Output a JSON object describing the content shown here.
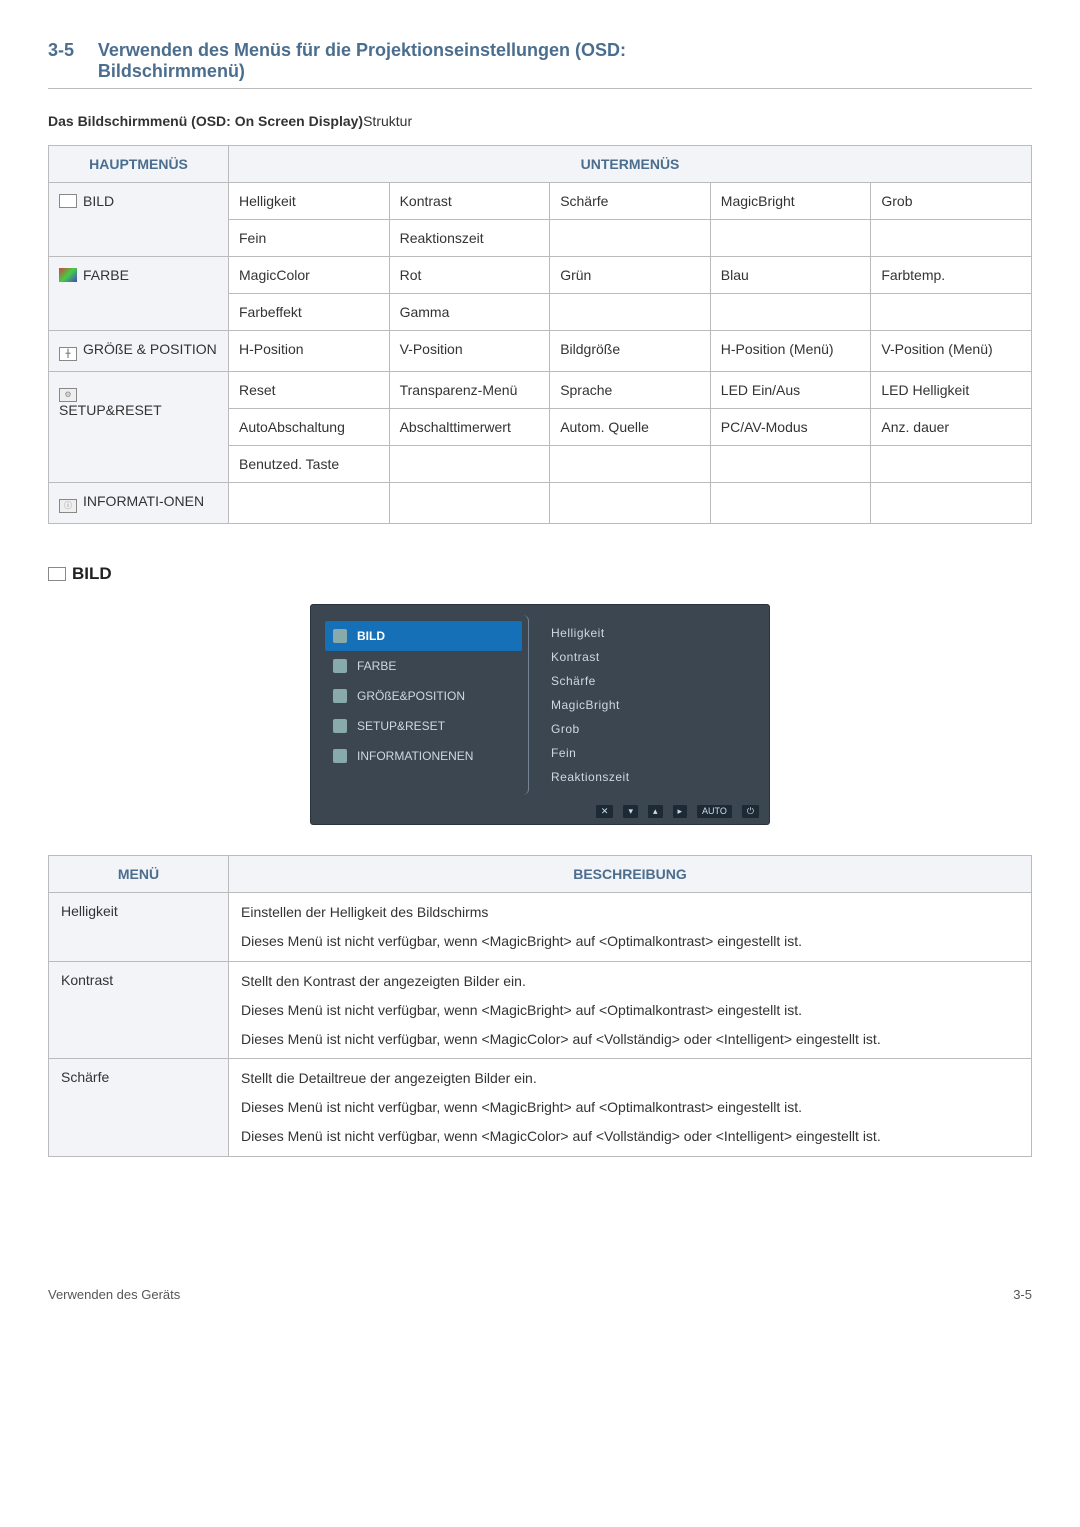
{
  "header": {
    "number": "3-5",
    "title_line1": "Verwenden des Menüs für die Projektionseinstellungen (OSD:",
    "title_line2": "Bildschirmmenü)"
  },
  "intro_bold": "Das Bildschirmmenü (OSD: On Screen Display)",
  "intro_light": "Struktur",
  "structure_table": {
    "header_main": "HAUPTMENÜS",
    "header_sub": "UNTERMENÜS",
    "rows": [
      {
        "main": "BILD",
        "icon": "picture-icon",
        "sub": [
          [
            "Helligkeit",
            "Kontrast",
            "Schärfe",
            "MagicBright",
            "Grob"
          ],
          [
            "Fein",
            "Reaktionszeit",
            "",
            "",
            ""
          ]
        ]
      },
      {
        "main": "FARBE",
        "icon": "color-icon",
        "sub": [
          [
            "MagicColor",
            "Rot",
            "Grün",
            "Blau",
            "Farbtemp."
          ],
          [
            "Farbeffekt",
            "Gamma",
            "",
            "",
            ""
          ]
        ]
      },
      {
        "main": "GRÖßE & POSITION",
        "icon": "size-icon",
        "sub": [
          [
            "H-Position",
            "V-Position",
            "Bildgröße",
            "H-Position (Menü)",
            "V-Position (Menü)"
          ]
        ]
      },
      {
        "main": "SETUP&RESET",
        "icon": "setup-icon",
        "sub": [
          [
            "Reset",
            "Transparenz-Menü",
            "Sprache",
            "LED Ein/Aus",
            "LED Helligkeit"
          ],
          [
            "AutoAbschaltung",
            "Abschalttimerwert",
            "Autom. Quelle",
            "PC/AV-Modus",
            "Anz. dauer"
          ],
          [
            "Benutzed. Taste",
            "",
            "",
            "",
            ""
          ]
        ]
      },
      {
        "main": "INFORMATI-ONEN",
        "icon": "info-icon",
        "sub": [
          [
            "",
            "",
            "",
            "",
            ""
          ]
        ]
      }
    ]
  },
  "bild_heading": "BILD",
  "osd": {
    "left": [
      {
        "label": "BILD",
        "active": true
      },
      {
        "label": "FARBE",
        "active": false
      },
      {
        "label": "GRÖßE&POSITION",
        "active": false
      },
      {
        "label": "SETUP&RESET",
        "active": false
      },
      {
        "label": "INFORMATIONENEN",
        "active": false
      }
    ],
    "right": [
      "Helligkeit",
      "Kontrast",
      "Schärfe",
      "MagicBright",
      "Grob",
      "Fein",
      "Reaktionszeit"
    ],
    "footer": [
      "✕",
      "▾",
      "▴",
      "▸",
      "AUTO",
      "⏻"
    ]
  },
  "desc_table": {
    "header_menu": "MENÜ",
    "header_desc": "BESCHREIBUNG",
    "rows": [
      {
        "menu": "Helligkeit",
        "desc": [
          "Einstellen der Helligkeit des Bildschirms",
          "Dieses Menü ist nicht verfügbar, wenn <MagicBright> auf <Optimalkontrast> eingestellt ist."
        ]
      },
      {
        "menu": "Kontrast",
        "desc": [
          "Stellt den Kontrast der angezeigten Bilder ein.",
          "Dieses Menü ist nicht verfügbar, wenn <MagicBright> auf <Optimalkontrast> eingestellt ist.",
          "Dieses Menü ist nicht verfügbar, wenn <MagicColor> auf <Vollständig> oder <Intelligent> eingestellt ist."
        ]
      },
      {
        "menu": "Schärfe",
        "desc": [
          "Stellt die Detailtreue der angezeigten Bilder ein.",
          "Dieses Menü ist nicht verfügbar, wenn <MagicBright> auf <Optimalkontrast> eingestellt ist.",
          "Dieses Menü ist nicht verfügbar, wenn <MagicColor> auf <Vollständig> oder <Intelligent> eingestellt ist."
        ]
      }
    ]
  },
  "footer_left": "Verwenden des Geräts",
  "footer_right": "3-5"
}
